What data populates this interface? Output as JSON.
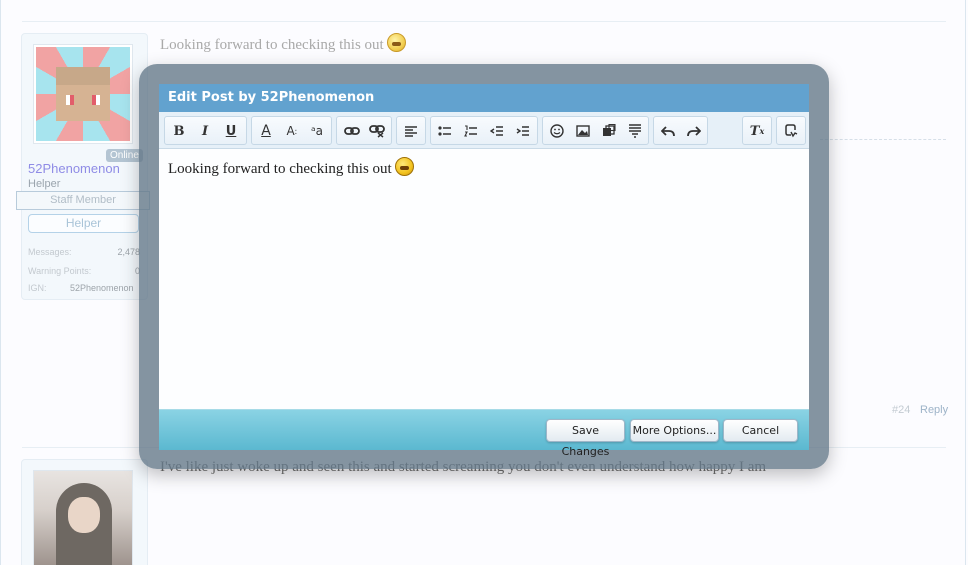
{
  "background": {
    "post1": {
      "text": "Looking forward to checking this out",
      "user": {
        "online_badge": "Online",
        "name": "52Phenomenon",
        "title": "Helper",
        "staff_banner": "Staff Member",
        "group_button": "Helper",
        "stats": [
          {
            "label": "Messages:",
            "value": "2,478"
          },
          {
            "label": "Warning Points:",
            "value": "0"
          },
          {
            "label": "IGN:",
            "value": "52Phenomenon"
          }
        ]
      },
      "post_number": "#24",
      "reply_link": "Reply"
    },
    "post2": {
      "text": "I've like just woke up and seen this and started screaming you don't even understand how happy I am"
    }
  },
  "dialog": {
    "title": "Edit Post by 52Phenomenon",
    "toolbar_icons": [
      "bold-icon",
      "italic-icon",
      "underline-icon",
      "text-color-icon",
      "font-size-icon",
      "font-family-icon",
      "link-icon",
      "unlink-icon",
      "align-icon",
      "bullet-list-icon",
      "numbered-list-icon",
      "outdent-icon",
      "indent-icon",
      "smilie-icon",
      "image-icon",
      "media-icon",
      "quote-icon",
      "undo-icon",
      "redo-icon",
      "remove-format-icon",
      "toggle-bbcode-icon"
    ],
    "editor_text": "Looking forward to checking this out",
    "buttons": {
      "save": "Save Changes",
      "more": "More Options...",
      "cancel": "Cancel"
    }
  },
  "colors": {
    "title_bar": "#62a2cf",
    "footer": "#5bb8d0",
    "overlay": "#617687",
    "username": "#8f8ce6"
  }
}
